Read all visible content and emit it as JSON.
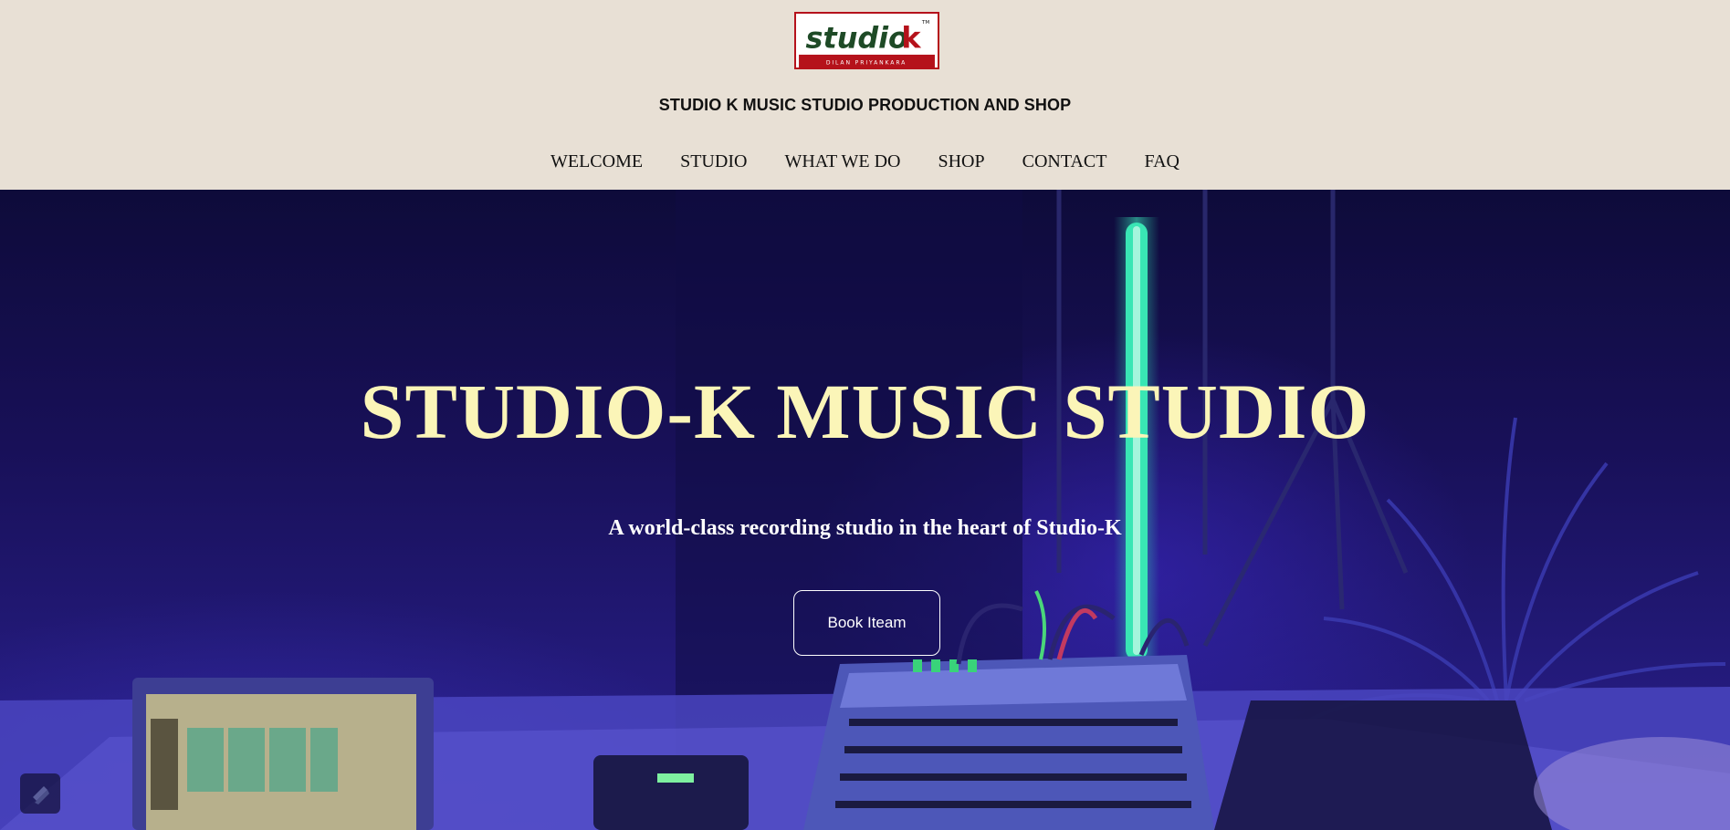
{
  "header": {
    "logo": {
      "wordmark": "studiok",
      "tagline": "DILAN PRIYANKARA",
      "trademark": "TM"
    },
    "site_title": "STUDIO K MUSIC STUDIO PRODUCTION AND SHOP"
  },
  "nav": {
    "items": [
      {
        "label": "WELCOME"
      },
      {
        "label": "STUDIO"
      },
      {
        "label": "WHAT WE DO"
      },
      {
        "label": "SHOP"
      },
      {
        "label": "CONTACT"
      },
      {
        "label": "FAQ"
      }
    ]
  },
  "hero": {
    "title": "STUDIO-K MUSIC STUDIO",
    "subtitle": "A world-class recording studio in the heart of Studio-K",
    "button_label": "Book Iteam",
    "background_image": "recording studio with laptop, audio mixer and neon light tube"
  },
  "colors": {
    "header_bg": "#e8e0d5",
    "hero_title": "#fbf5b8",
    "logo_red": "#b5121b",
    "logo_green": "#1e4a26"
  },
  "widgets": {
    "corner_icon": "brand-badge-icon"
  }
}
